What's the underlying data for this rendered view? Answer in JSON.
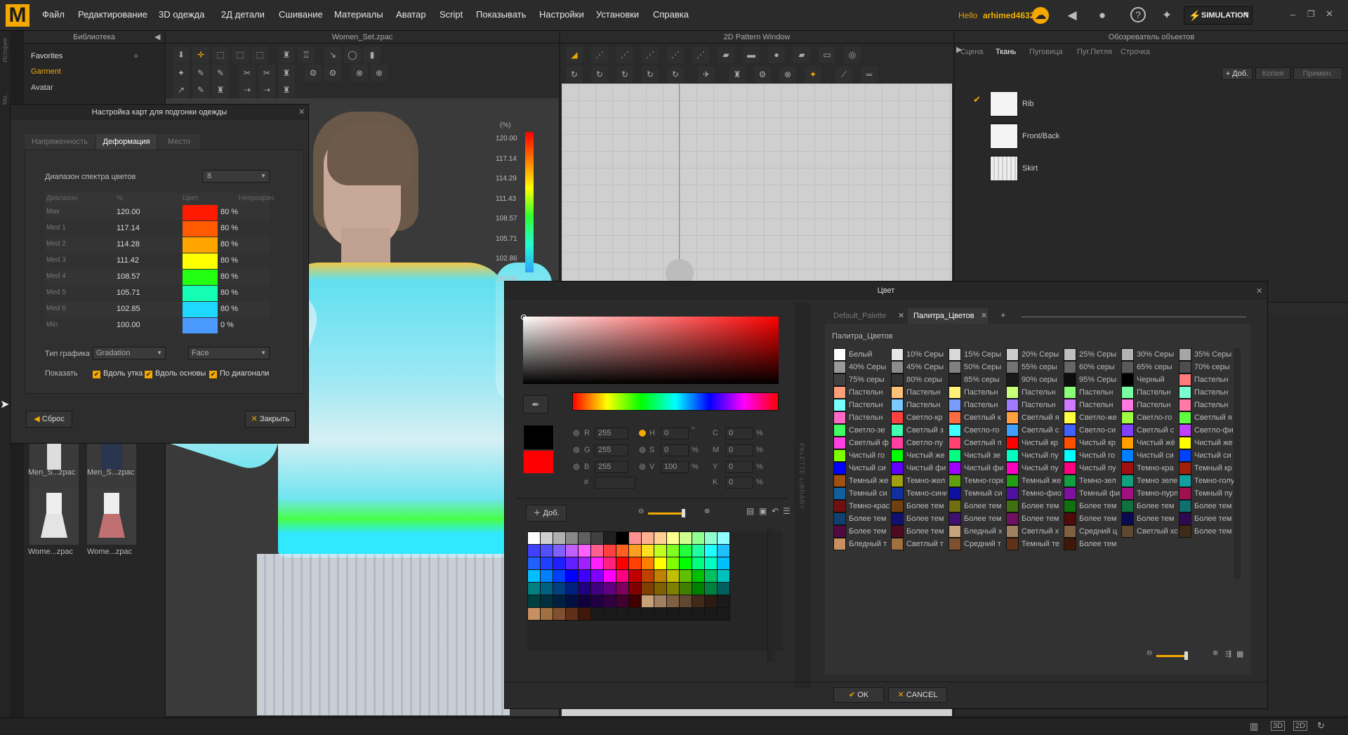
{
  "menubar": {
    "logo": "M",
    "items": [
      "Файл",
      "Редактирование",
      "3D одежда",
      "2Д детали",
      "Сшивание",
      "Материалы",
      "Аватар",
      "Script",
      "Показывать",
      "Настройки",
      "Установки",
      "Справка"
    ],
    "hello": "Hello",
    "user": "arhimed46321",
    "mode": "SIMULATION"
  },
  "library": {
    "title": "Библиотека",
    "items": [
      "Favorites",
      "Garment",
      "Avatar"
    ],
    "thumbs": [
      "Men_S...zpac",
      "Men_S...zpac",
      "Wome...zpac",
      "Wome...zpac"
    ],
    "side_tabs": [
      "История",
      "Мо..."
    ]
  },
  "viewport3d": {
    "title": "Women_Set.zpac",
    "legend_unit": "(%)",
    "legend_values": [
      "120.00",
      "117.14",
      "114.29",
      "111.43",
      "108.57",
      "105.71",
      "102.86",
      "100.00"
    ]
  },
  "pattern2d": {
    "title": "2D Pattern Window",
    "side_label": "PALETTE LIBRARY"
  },
  "objbrowser": {
    "title": "Обозреватель объектов",
    "tabs": [
      "Сцена",
      "Ткань",
      "Пуговица",
      "Пуг.Петля",
      "Строчка"
    ],
    "active_tab": "Ткань",
    "buttons": [
      "+ Доб.",
      "Копия",
      "Примен."
    ],
    "fabrics": [
      {
        "name": "Rib",
        "selected": true
      },
      {
        "name": "Front/Back",
        "selected": false
      },
      {
        "name": "Skirt",
        "selected": false
      }
    ]
  },
  "fitmap": {
    "title": "Настройка карт для подгонки одежды",
    "tabs": [
      "Напряженность",
      "Деформация",
      "Место"
    ],
    "active_tab": "Деформация",
    "spectrum_label": "Диапазон спектра цветов",
    "spectrum_value": "8",
    "headers": [
      "Диапазон",
      "%",
      "Цвет",
      "Непрозрач."
    ],
    "rows": [
      {
        "range": "Max",
        "pct": "120.00",
        "color": "#ff1a00",
        "opacity": "80 %"
      },
      {
        "range": "Med 1",
        "pct": "117.14",
        "color": "#ff5a00",
        "opacity": "80 %"
      },
      {
        "range": "Med 2",
        "pct": "114.28",
        "color": "#ffa500",
        "opacity": "80 %"
      },
      {
        "range": "Med 3",
        "pct": "111.42",
        "color": "#ffff00",
        "opacity": "80 %"
      },
      {
        "range": "Med 4",
        "pct": "108.57",
        "color": "#22ff10",
        "opacity": "80 %"
      },
      {
        "range": "Med 5",
        "pct": "105.71",
        "color": "#14ffb4",
        "opacity": "80 %"
      },
      {
        "range": "Med 6",
        "pct": "102.85",
        "color": "#1ed8ff",
        "opacity": "80 %"
      },
      {
        "range": "Min",
        "pct": "100.00",
        "color": "#4a9aff",
        "opacity": "0 %"
      }
    ],
    "graph_type_label": "Тип графика",
    "graph_type": "Gradation",
    "face": "Face",
    "show_label": "Показать",
    "checks": [
      "Вдоль утка",
      "Вдоль основы",
      "По диагонали"
    ],
    "reset": "Сброс",
    "close": "Закрыть"
  },
  "colordlg": {
    "title": "Цвет",
    "R": "255",
    "G": "255",
    "B": "255",
    "H": "0",
    "S": "0",
    "V": "100",
    "C": "0",
    "M": "0",
    "Y": "0",
    "K": "0",
    "hash_label": "#",
    "add": "Доб.",
    "palette_tabs": [
      "Default_Palette",
      "Палитра_Цветов"
    ],
    "palette_title": "Палитра_Цветов",
    "ok": "OK",
    "cancel": "CANCEL",
    "palette": [
      [
        "Белый",
        "#ffffff"
      ],
      [
        "10% Серы",
        "#e6e6e6"
      ],
      [
        "15% Серы",
        "#d9d9d9"
      ],
      [
        "20% Серы",
        "#cccccc"
      ],
      [
        "25% Серы",
        "#bfbfbf"
      ],
      [
        "30% Серы",
        "#b3b3b3"
      ],
      [
        "35% Серы",
        "#a6a6a6"
      ],
      [
        "40% Серы",
        "#999999"
      ],
      [
        "45% Серы",
        "#8c8c8c"
      ],
      [
        "50% Серы",
        "#808080"
      ],
      [
        "55% серы",
        "#737373"
      ],
      [
        "60% серы",
        "#666666"
      ],
      [
        "65% серы",
        "#595959"
      ],
      [
        "70% серы",
        "#4d4d4d"
      ],
      [
        "75% серы",
        "#404040"
      ],
      [
        "80% серы",
        "#333333"
      ],
      [
        "85% серы",
        "#262626"
      ],
      [
        "90% серы",
        "#1a1a1a"
      ],
      [
        "95% Серы",
        "#0d0d0d"
      ],
      [
        "Черный",
        "#000000"
      ],
      [
        "Пастельн",
        "#ff7a7a"
      ],
      [
        "Пастельн",
        "#ff9f7a"
      ],
      [
        "Пастельн",
        "#ffc07a"
      ],
      [
        "Пастельн",
        "#fff07a"
      ],
      [
        "Пастельн",
        "#c8ff7a"
      ],
      [
        "Пастельн",
        "#8cff7a"
      ],
      [
        "Пастельн",
        "#7affa0"
      ],
      [
        "Пастельн",
        "#7affd0"
      ],
      [
        "Пастельн",
        "#7affff"
      ],
      [
        "Пастельн",
        "#7acaff"
      ],
      [
        "Пастельн",
        "#7a9cff"
      ],
      [
        "Пастельн",
        "#a07aff"
      ],
      [
        "Пастельн",
        "#d07aff"
      ],
      [
        "Пастельн",
        "#ff7ae0"
      ],
      [
        "Пастельн",
        "#ff7aa6"
      ],
      [
        "Пастельн",
        "#ff68c8"
      ],
      [
        "Светло-кр",
        "#ff4040"
      ],
      [
        "Светлый к",
        "#ff6a40"
      ],
      [
        "Светлый я",
        "#ffa040"
      ],
      [
        "Светло-же",
        "#ffff40"
      ],
      [
        "Светло-го",
        "#a0ff40"
      ],
      [
        "Светлый я",
        "#60ff40"
      ],
      [
        "Светло-зе",
        "#40ff60"
      ],
      [
        "Светлый з",
        "#40ffb0"
      ],
      [
        "Светло-го",
        "#40ffff"
      ],
      [
        "Светлый с",
        "#40a0ff"
      ],
      [
        "Светло-си",
        "#4060ff"
      ],
      [
        "Светлый с",
        "#8040ff"
      ],
      [
        "Светло-фи",
        "#c040ff"
      ],
      [
        "Светлый ф",
        "#ff40e0"
      ],
      [
        "Светло-пу",
        "#ff40a0"
      ],
      [
        "Светлый п",
        "#ff4070"
      ],
      [
        "Чистый кр",
        "#ff0000"
      ],
      [
        "Чистый кр",
        "#ff5000"
      ],
      [
        "Чистый жё",
        "#ffa000"
      ],
      [
        "Чистый же",
        "#ffff00"
      ],
      [
        "Чистый го",
        "#80ff00"
      ],
      [
        "Чистый же",
        "#00ff00"
      ],
      [
        "Чистый зе",
        "#00ff80"
      ],
      [
        "Чистый пу",
        "#00ffc0"
      ],
      [
        "Чистый го",
        "#00ffff"
      ],
      [
        "Чистый си",
        "#0080ff"
      ],
      [
        "Чистый си",
        "#0040ff"
      ],
      [
        "Чистый си",
        "#0000ff"
      ],
      [
        "Чистый фи",
        "#6000ff"
      ],
      [
        "Чистый фи",
        "#a000ff"
      ],
      [
        "Чистый пу",
        "#ff00c0"
      ],
      [
        "Чистый пу",
        "#ff0080"
      ],
      [
        "Темно-кра",
        "#a01010"
      ],
      [
        "Темный кр",
        "#a02010"
      ],
      [
        "Темный же",
        "#a05010"
      ],
      [
        "Темно-жел",
        "#a0a010"
      ],
      [
        "Темно-горк",
        "#60a010"
      ],
      [
        "Темный же",
        "#20a010"
      ],
      [
        "Темно-зел",
        "#10a040"
      ],
      [
        "Темно зеле",
        "#10a080"
      ],
      [
        "Темно-голу",
        "#10a0a0"
      ],
      [
        "Темный си",
        "#1060a0"
      ],
      [
        "Темно-сини",
        "#1030a0"
      ],
      [
        "Темный си",
        "#1010a0"
      ],
      [
        "Темно-фио",
        "#5010a0"
      ],
      [
        "Темный фи",
        "#8010a0"
      ],
      [
        "Темно-пурп",
        "#a01080"
      ],
      [
        "Темный пу",
        "#a01050"
      ],
      [
        "Темно-крас",
        "#701010"
      ],
      [
        "Более тем",
        "#704010"
      ],
      [
        "Более тем",
        "#707010"
      ],
      [
        "Более тем",
        "#407010"
      ],
      [
        "Более тем",
        "#107010"
      ],
      [
        "Более тем",
        "#107040"
      ],
      [
        "Более тем",
        "#107070"
      ],
      [
        "Более тем",
        "#104070"
      ],
      [
        "Более тем",
        "#101070"
      ],
      [
        "Более тем",
        "#401070"
      ],
      [
        "Более тем",
        "#701060"
      ],
      [
        "Более тем",
        "#500a0a"
      ],
      [
        "Более тем",
        "#0a0a50"
      ],
      [
        "Более тем",
        "#300a50"
      ],
      [
        "Более тем",
        "#500a40"
      ],
      [
        "Более тем",
        "#500a20"
      ],
      [
        "Бледный х",
        "#c8a27a"
      ],
      [
        "Светлый х",
        "#a08060"
      ],
      [
        "Средний ц",
        "#806040"
      ],
      [
        "Светлый хо",
        "#604830"
      ],
      [
        "Более тем",
        "#402a18"
      ],
      [
        "Бледный т",
        "#c89060"
      ],
      [
        "Светлый т",
        "#a07040"
      ],
      [
        "Средний т",
        "#805030"
      ],
      [
        "Темный те",
        "#603018"
      ],
      [
        "Более тем",
        "#401808"
      ]
    ]
  }
}
